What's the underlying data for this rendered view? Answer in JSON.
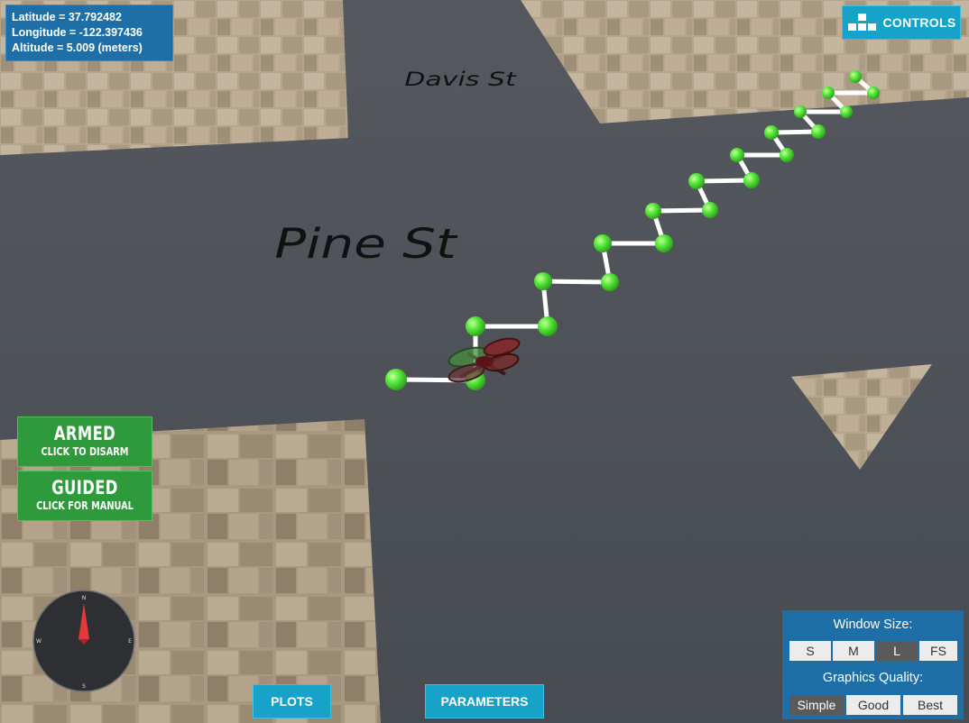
{
  "telemetry": {
    "latitude_text": "Latitude = 37.792482",
    "longitude_text": "Longitude = -122.397436",
    "altitude_text": "Altitude = 5.009 (meters)"
  },
  "controls_button": {
    "label": "CONTROLS",
    "icon": "grid-blocks-icon"
  },
  "streets": {
    "top": "Davis St",
    "middle": "Pine St"
  },
  "mode_buttons": {
    "armed": {
      "title": "ARMED",
      "subtitle": "CLICK TO DISARM"
    },
    "guided": {
      "title": "GUIDED",
      "subtitle": "CLICK FOR MANUAL"
    }
  },
  "compass": {
    "n": "N",
    "e": "E",
    "s": "S",
    "w": "W"
  },
  "bottom_buttons": {
    "plots": "PLOTS",
    "parameters": "PARAMETERS"
  },
  "window_size": {
    "title": "Window Size:",
    "options": [
      "S",
      "M",
      "L",
      "FS"
    ],
    "selected": "L"
  },
  "graphics_quality": {
    "title": "Graphics Quality:",
    "options": [
      "Simple",
      "Good",
      "Best"
    ],
    "selected": "Simple"
  },
  "colors": {
    "waypoint": "#55e83a",
    "road": "#4d5158",
    "panel_blue": "#1e6fa8",
    "button_cyan": "#17a3c9",
    "mode_green": "#2e9a3b"
  }
}
